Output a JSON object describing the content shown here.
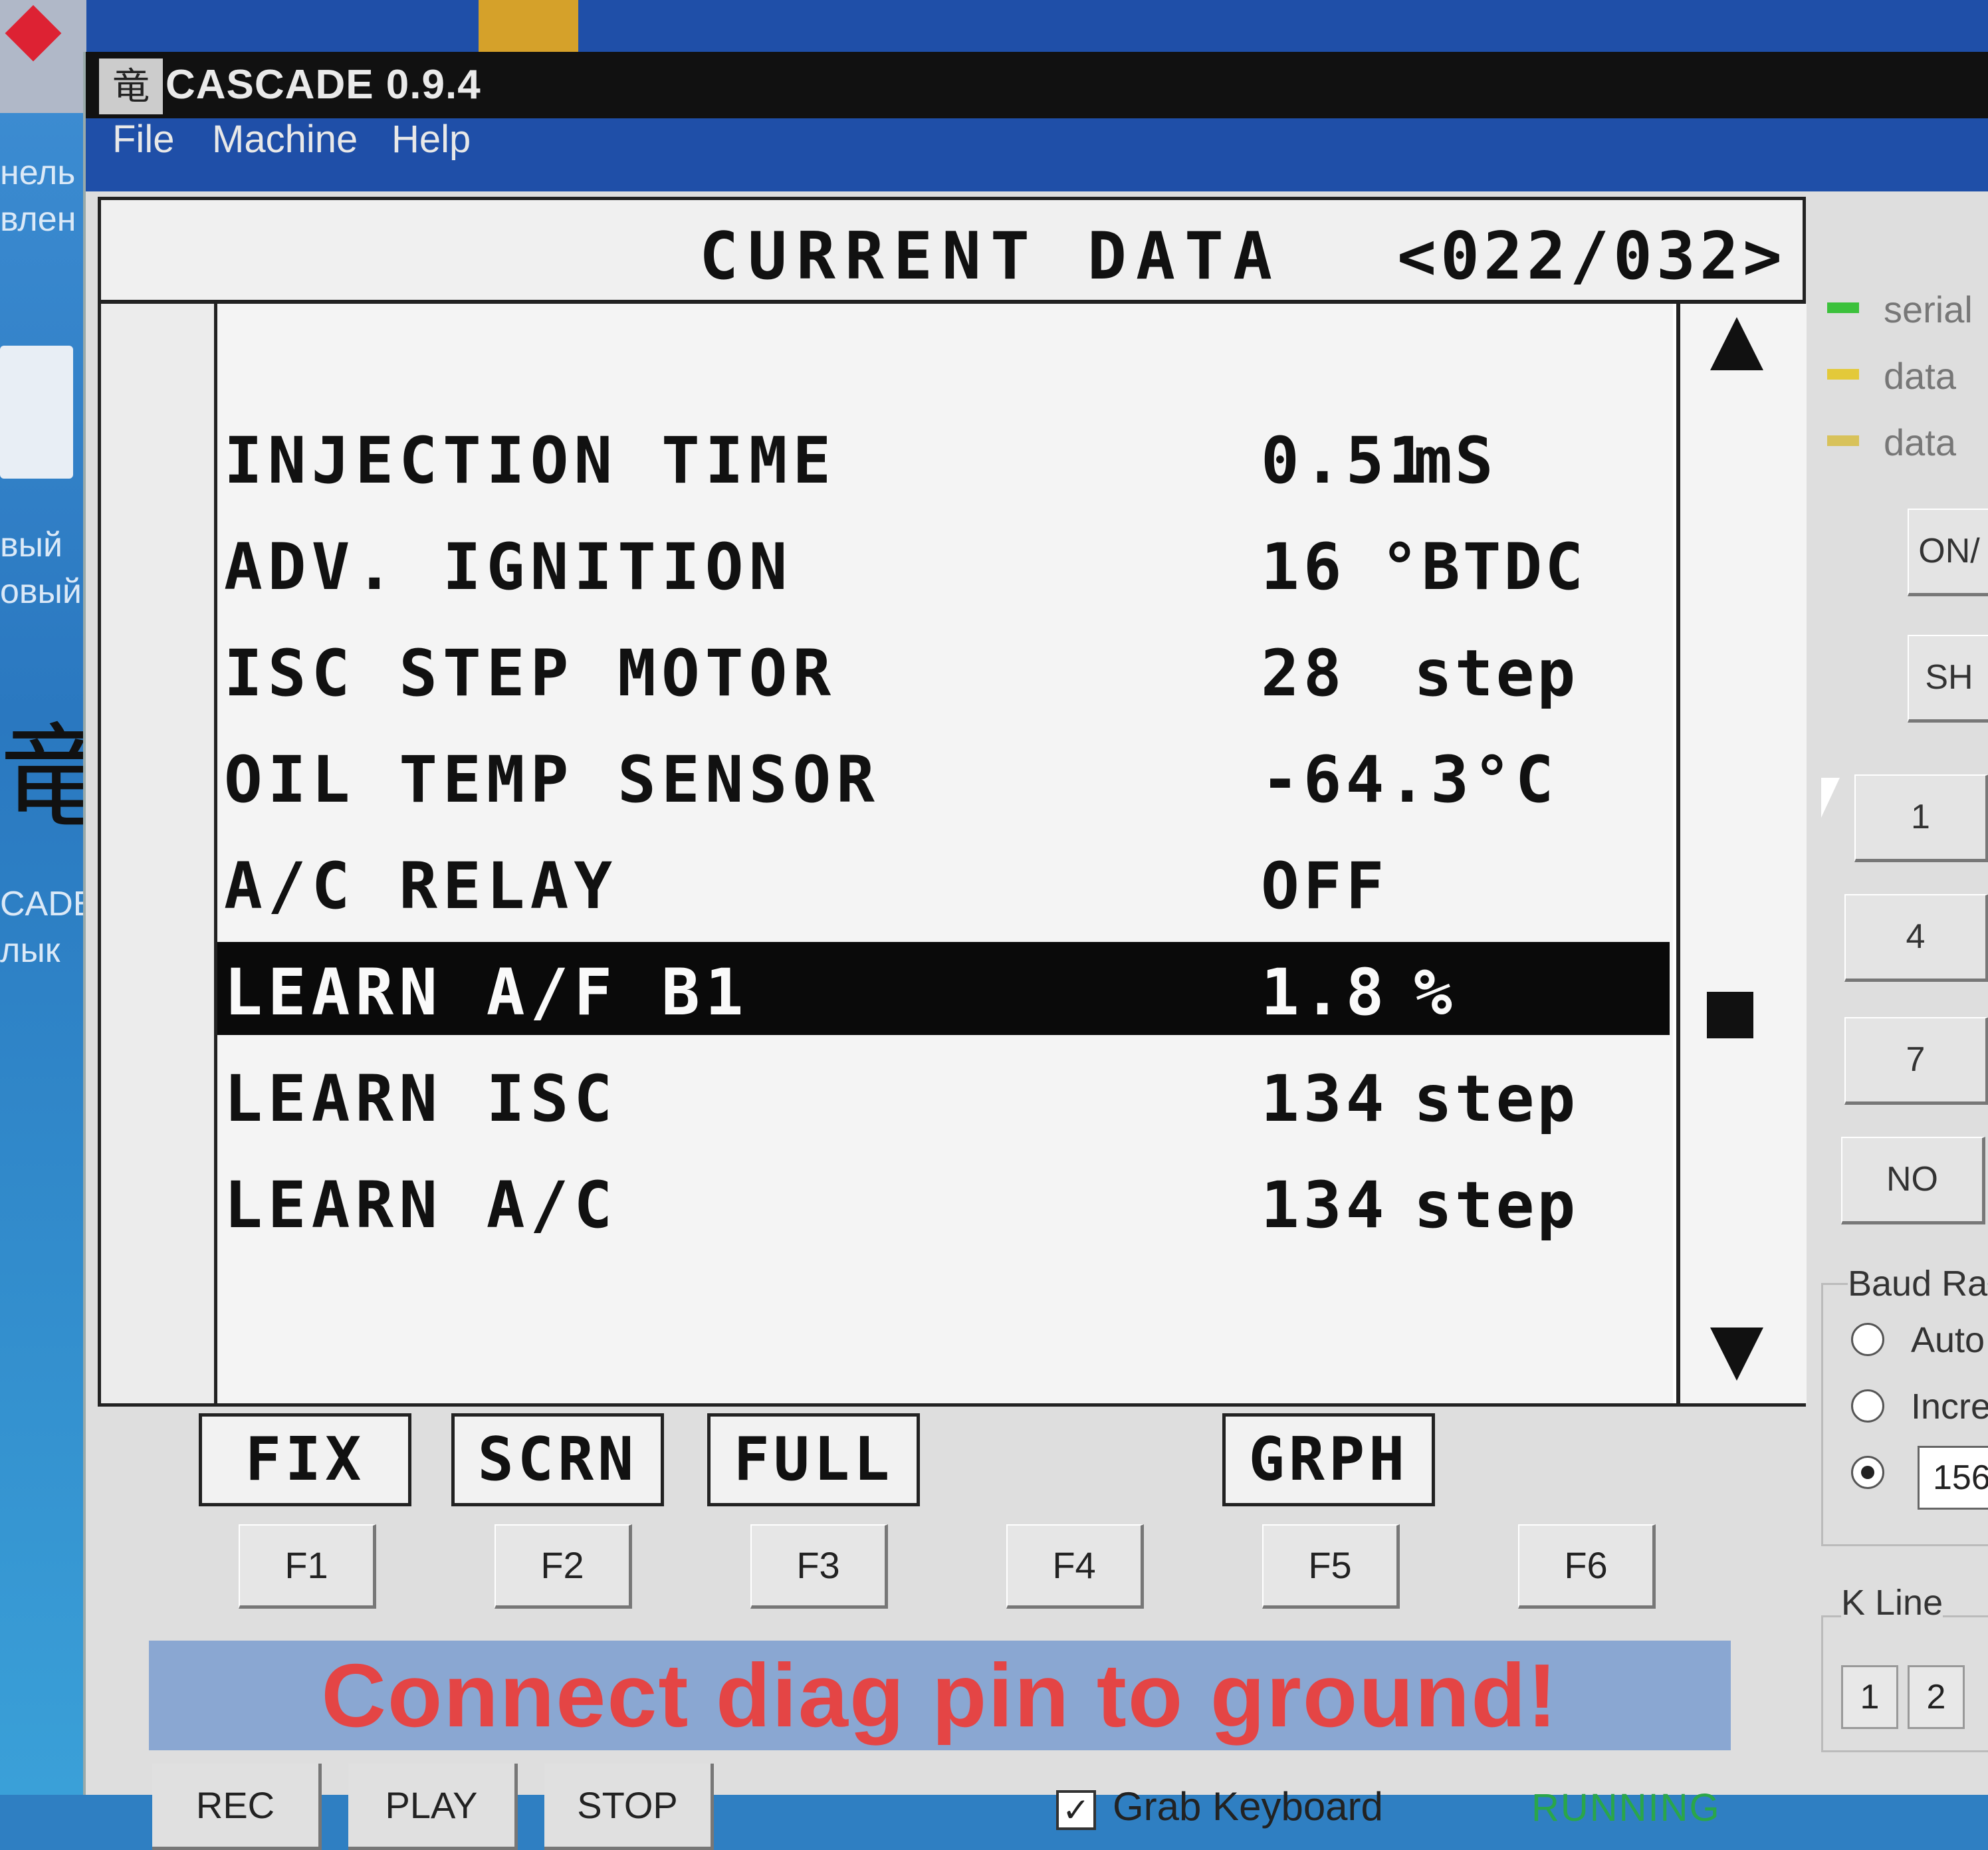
{
  "window": {
    "title": "CASCADE 0.9.4",
    "icon_glyph": "竜"
  },
  "desktop": {
    "left_labels": [
      "нель",
      "влен",
      "вый",
      "овый",
      "CADE",
      "лык"
    ],
    "icon_glyph": "竜"
  },
  "menu": [
    "File",
    "Machine",
    "Help"
  ],
  "screen": {
    "title": "CURRENT DATA",
    "page": "<022/032>",
    "selected_index": 5,
    "rows": [
      {
        "label": "INJECTION TIME",
        "value": "0.51",
        "unit": "mS"
      },
      {
        "label": "ADV. IGNITION",
        "value": "16",
        "unit": "°BTDC"
      },
      {
        "label": "ISC STEP MOTOR",
        "value": "28",
        "unit": "step"
      },
      {
        "label": "OIL TEMP SENSOR",
        "value": "-64.3°C",
        "unit": ""
      },
      {
        "label": "A/C RELAY",
        "value": "OFF",
        "unit": ""
      },
      {
        "label": "LEARN A/F B1",
        "value": "1.8",
        "unit": "%"
      },
      {
        "label": "LEARN ISC",
        "value": "134",
        "unit": "step"
      },
      {
        "label": "LEARN A/C",
        "value": "134",
        "unit": "step"
      }
    ],
    "soft_labels": [
      "FIX",
      "SCRN",
      "FULL",
      "GRPH"
    ]
  },
  "function_keys": [
    "F1",
    "F2",
    "F3",
    "F4",
    "F5",
    "F6"
  ],
  "status": {
    "message": "Connect diag pin to ground!",
    "message_color": "#e44545",
    "state": "RUNNING",
    "state_color": "#2aa64a"
  },
  "controls": {
    "rec": "REC",
    "play": "PLAY",
    "stop": "STOP",
    "grab_keyboard": "Grab Keyboard",
    "grab_keyboard_checked": true,
    "check_mark": "✓"
  },
  "right_panel": {
    "indicators": [
      {
        "label": "serial",
        "color": "#3cc13c"
      },
      {
        "label": "data",
        "color": "#e3c93a"
      },
      {
        "label": "data",
        "color": "#d8c25a"
      }
    ],
    "buttons": [
      "ON/",
      "SH",
      "1",
      "4",
      "7",
      "NO"
    ],
    "baud_rate_label": "Baud Ra",
    "baud_options": [
      "Auto",
      "Incre"
    ],
    "baud_value": "156",
    "k_line_label": "K Line",
    "k_line_buttons": [
      "1",
      "2"
    ]
  }
}
